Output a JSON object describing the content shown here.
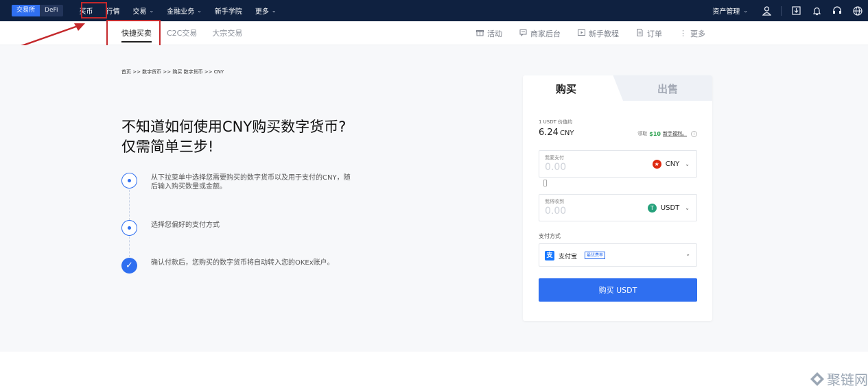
{
  "topbar": {
    "switch": {
      "exchange": "交易所",
      "defi": "DeFi"
    },
    "nav": [
      {
        "label": "买币",
        "chevron": false
      },
      {
        "label": "行情",
        "chevron": false
      },
      {
        "label": "交易",
        "chevron": true
      },
      {
        "label": "金融业务",
        "chevron": true
      },
      {
        "label": "新手学院",
        "chevron": false
      },
      {
        "label": "更多",
        "chevron": true
      }
    ],
    "asset_label": "资产管理"
  },
  "subnav": {
    "tabs": [
      "快捷买卖",
      "C2C交易",
      "大宗交易"
    ],
    "active_tab": "快捷买卖",
    "right": [
      "活动",
      "商家后台",
      "新手教程",
      "订单",
      "更多"
    ]
  },
  "breadcrumb": "首页 >> 数字货币 >> 购买 数字货币 >> CNY",
  "headline": {
    "line1": "不知道如何使用CNY购买数字货币?",
    "line2": "仅需简单三步!"
  },
  "steps": [
    {
      "text": "从下拉菜单中选择您需要购买的数字货币以及用于支付的CNY，随后输入购买数量或金额。"
    },
    {
      "text": "选择您偏好的支付方式"
    },
    {
      "text": "确认付款后，您购买的数字货币将自动转入您的OKEx账户。"
    }
  ],
  "card": {
    "tab_buy": "购买",
    "tab_sell": "出售",
    "rate_label": "1 USDT 价值约",
    "rate_value": "6.24",
    "rate_unit": "CNY",
    "promo": {
      "prefix": "领取",
      "amount": "$10",
      "link": "新手福利。"
    },
    "pay_field": {
      "label": "我要支付",
      "placeholder": "0.00",
      "currency": "CNY"
    },
    "receive_field": {
      "label": "我将收到",
      "placeholder": "0.00",
      "currency": "USDT"
    },
    "pay_method_label": "支付方式",
    "pay_method": {
      "name": "支付宝",
      "tag": "最优费率"
    },
    "buy_button": "购买 USDT"
  },
  "watermark": "聚链网",
  "colors": {
    "navbar": "#0f2140",
    "accent": "#2f6ff0",
    "highlight": "#c4282b",
    "promo": "#2ba14e"
  }
}
